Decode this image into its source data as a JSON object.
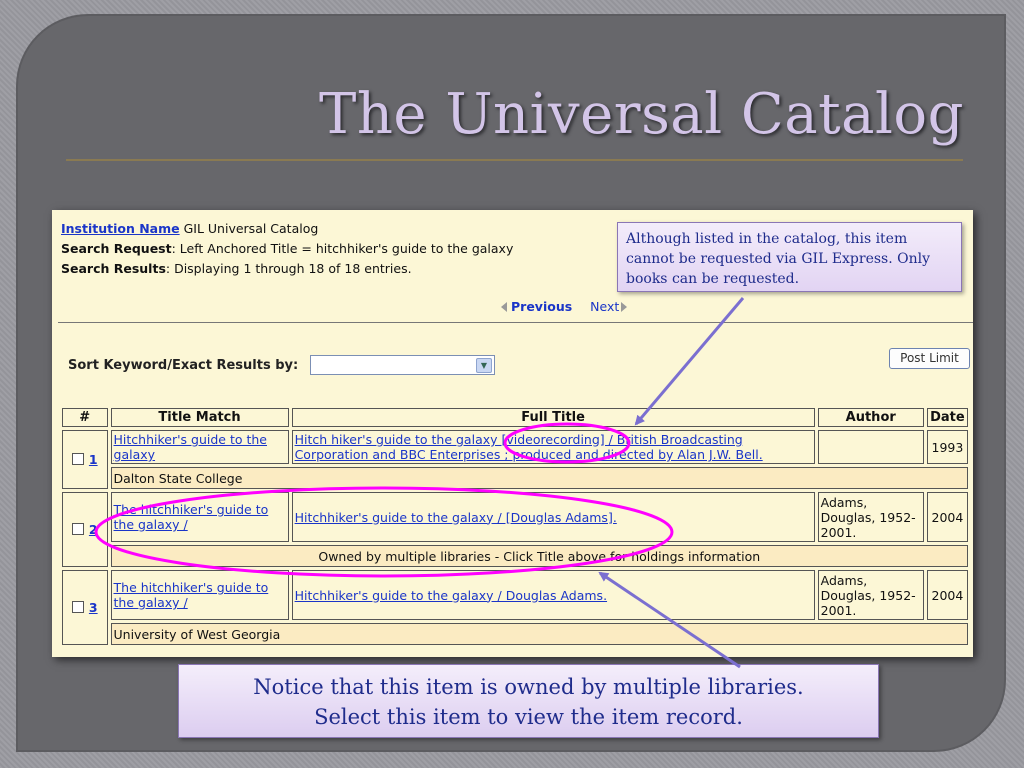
{
  "slide": {
    "title": "The Universal Catalog"
  },
  "catalog": {
    "institution_label": "Institution Name",
    "institution_value": " GIL Universal Catalog",
    "search_request_label": "Search Request",
    "search_request_value": ": Left Anchored Title = hitchhiker's guide to the galaxy",
    "search_results_label": "Search Results",
    "search_results_value": ": Displaying 1 through 18 of 18 entries.",
    "previous_label": "Previous",
    "next_label": "Next",
    "sort_label": "Sort Keyword/Exact Results by:",
    "sort_value": "",
    "post_limit_label": "Post Limit",
    "columns": [
      "#",
      "Title Match",
      "Full Title",
      "Author",
      "Date"
    ],
    "rows": [
      {
        "num": "1",
        "title_match": "Hitchhiker's guide to the galaxy",
        "full_title": "Hitch hiker's guide to the galaxy [videorecording] / British Broadcasting Corporation and BBC Enterprises ; produced and directed by Alan J.W. Bell.",
        "author": "",
        "date": "1993",
        "holdings": "Dalton State College"
      },
      {
        "num": "2",
        "title_match": "The hitchhiker's guide to the galaxy /",
        "full_title": "Hitchhiker's guide to the galaxy / [Douglas Adams].",
        "author": "Adams, Douglas, 1952-2001.",
        "date": "2004",
        "holdings": "Owned by multiple libraries - Click Title above for holdings information"
      },
      {
        "num": "3",
        "title_match": "The hitchhiker's guide to the galaxy /",
        "full_title": "Hitchhiker's guide to the galaxy / Douglas Adams.",
        "author": "Adams, Douglas, 1952-2001.",
        "date": "2004",
        "holdings": "University of West Georgia"
      }
    ]
  },
  "callout_text": "Although listed in the catalog, this item cannot be requested via GIL Express. Only books can be requested.",
  "note": {
    "line1": "Notice that this item is owned by multiple libraries.",
    "line2": "Select this item to view the item record."
  },
  "colors": {
    "annotation": "#ff00ff",
    "arrow": "#7b6fd0",
    "link": "#1a35c8"
  }
}
